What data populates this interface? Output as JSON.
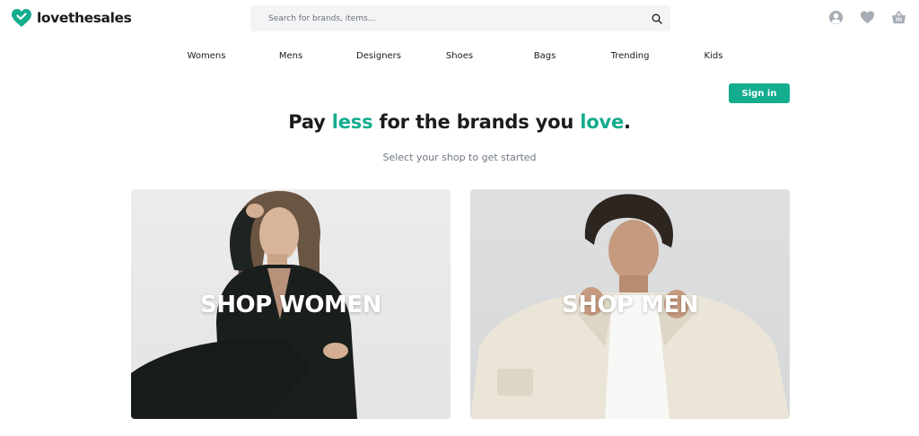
{
  "brand": {
    "name": "lovethesales",
    "accent_color": "#14ad8e"
  },
  "search": {
    "placeholder": "Search for brands, items..."
  },
  "header_icons": [
    "user-icon",
    "heart-icon",
    "basket-icon"
  ],
  "nav": {
    "items": [
      "Womens",
      "Mens",
      "Designers",
      "Shoes",
      "Bags",
      "Trending",
      "Kids"
    ]
  },
  "auth": {
    "signin_label": "Sign in"
  },
  "hero": {
    "headline_part1": "Pay ",
    "headline_accent1": "less",
    "headline_part2": " for the brands you ",
    "headline_accent2": "love",
    "headline_part3": ".",
    "subtitle": "Select your shop to get started"
  },
  "shops": {
    "women_label": "SHOP WOMEN",
    "men_label": "SHOP MEN"
  }
}
